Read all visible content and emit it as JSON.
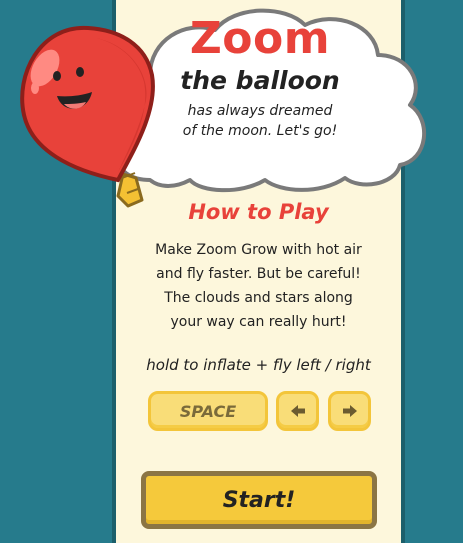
{
  "game": {
    "title": "Zoom",
    "subtitle": "the balloon",
    "tagline_lines": [
      "has always dreamed",
      "of the moon. Let's go!"
    ]
  },
  "instructions": {
    "heading": "How to Play",
    "lines": [
      "Make Zoom Grow with hot air",
      "and fly faster. But be careful!",
      "The clouds and stars along",
      "your way can really hurt!"
    ],
    "controls_text": "hold to inflate + fly left / right"
  },
  "keys": {
    "space_label": "SPACE",
    "left_icon": "arrow-left-icon",
    "right_icon": "arrow-right-icon"
  },
  "start_button": {
    "label": "Start!"
  },
  "colors": {
    "background": "#267b8c",
    "panel": "#fdf7dc",
    "accent_red": "#e8423a",
    "key_yellow": "#f9dd78",
    "button_yellow": "#f5c93b"
  }
}
